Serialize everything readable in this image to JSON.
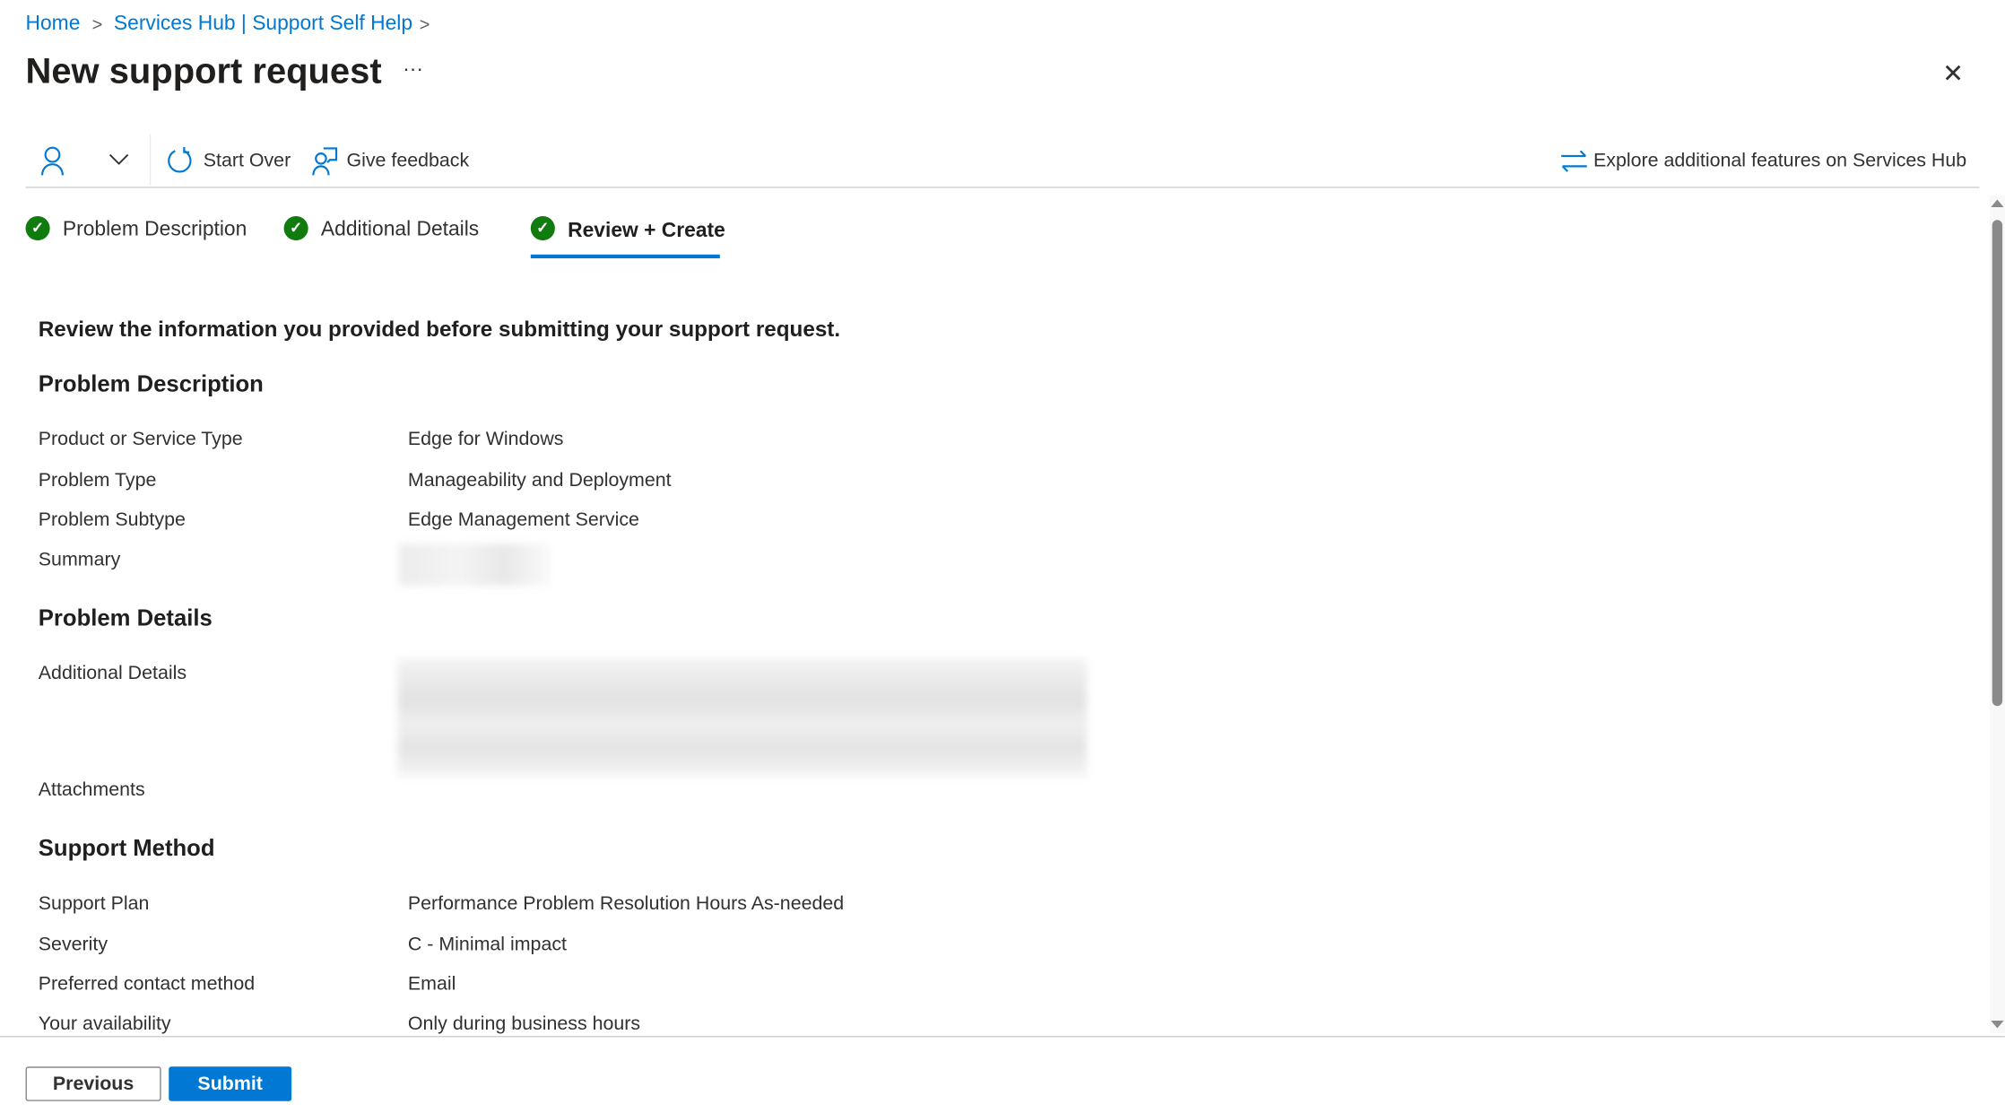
{
  "breadcrumb": {
    "items": [
      "Home",
      "Services Hub | Support Self Help"
    ]
  },
  "header": {
    "title": "New support request",
    "more": "···",
    "close": "✕"
  },
  "toolbar": {
    "start_over": "Start Over",
    "give_feedback": "Give feedback",
    "explore": "Explore additional features on Services Hub"
  },
  "tabs": [
    {
      "label": "Problem Description"
    },
    {
      "label": "Additional Details"
    },
    {
      "label": "Review + Create"
    }
  ],
  "intro": "Review the information you provided before submitting your support request.",
  "sections": {
    "problem_description": {
      "title": "Problem Description",
      "rows": [
        {
          "label": "Product or Service Type",
          "value": "Edge for Windows"
        },
        {
          "label": "Problem Type",
          "value": "Manageability and Deployment"
        },
        {
          "label": "Problem Subtype",
          "value": "Edge Management Service"
        },
        {
          "label": "Summary",
          "value": ""
        }
      ]
    },
    "problem_details": {
      "title": "Problem Details",
      "rows": [
        {
          "label": "Additional Details",
          "value": ""
        },
        {
          "label": "Attachments",
          "value": ""
        }
      ]
    },
    "support_method": {
      "title": "Support Method",
      "rows": [
        {
          "label": "Support Plan",
          "value": "Performance Problem Resolution Hours As-needed"
        },
        {
          "label": "Severity",
          "value": "C - Minimal impact"
        },
        {
          "label": "Preferred contact method",
          "value": "Email"
        },
        {
          "label": "Your availability",
          "value": "Only during business hours"
        }
      ]
    }
  },
  "footer": {
    "previous": "Previous",
    "submit": "Submit"
  },
  "colors": {
    "accent": "#0078d4",
    "success": "#107c10"
  }
}
